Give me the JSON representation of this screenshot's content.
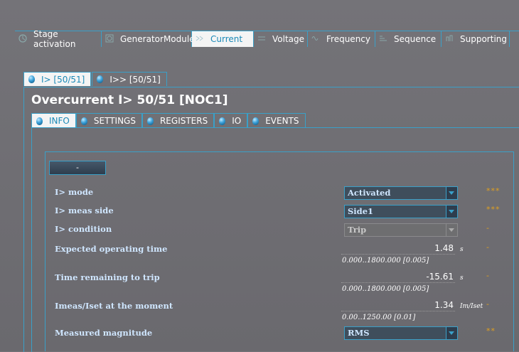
{
  "top_tabs": [
    {
      "label": "Stage activation",
      "icon": "stage-activation-icon"
    },
    {
      "label": "GeneratorModule",
      "icon": "generator-icon"
    },
    {
      "label": "Current",
      "icon": "current-icon"
    },
    {
      "label": "Voltage",
      "icon": "voltage-icon"
    },
    {
      "label": "Frequency",
      "icon": "frequency-icon"
    },
    {
      "label": "Sequence",
      "icon": "sequence-icon"
    },
    {
      "label": "Supporting",
      "icon": "supporting-icon"
    }
  ],
  "active_top_tab": "Current",
  "stage_tabs": [
    {
      "label": "I> [50/51]"
    },
    {
      "label": "I>> [50/51]"
    }
  ],
  "page_title": "Overcurrent I> 50/51 [NOC1]",
  "inner_tabs": [
    {
      "label": "INFO"
    },
    {
      "label": "SETTINGS"
    },
    {
      "label": "REGISTERS"
    },
    {
      "label": "IO"
    },
    {
      "label": "EVENTS"
    }
  ],
  "collapse_label": "-",
  "rows": {
    "mode": {
      "label": "I> mode",
      "value": "Activated",
      "flag": "***"
    },
    "meas_side": {
      "label": "I> meas side",
      "value": "Side1",
      "flag": "***"
    },
    "condition": {
      "label": "I> condition",
      "value": "Trip",
      "flag": "-"
    },
    "expected_time": {
      "label": "Expected operating time",
      "value": "1.48",
      "unit": "s",
      "range": "0.000..1800.000 [0.005]",
      "flag": "-"
    },
    "remaining": {
      "label": "Time remaining to trip",
      "value": "-15.61",
      "unit": "s",
      "range": "0.000..1800.000 [0.005]",
      "flag": "-"
    },
    "imeas": {
      "label": "Imeas/Iset at the moment",
      "value": "1.34",
      "unit": "Im/Iset",
      "range": "0.00..1250.00 [0.01]",
      "flag": "-"
    },
    "magnitude": {
      "label": "Measured magnitude",
      "value": "RMS",
      "flag": "**"
    }
  },
  "colors": {
    "accent": "#3aa0c8",
    "background": "#707075",
    "label": "#cfe6ff",
    "flag": "#e0a020"
  }
}
